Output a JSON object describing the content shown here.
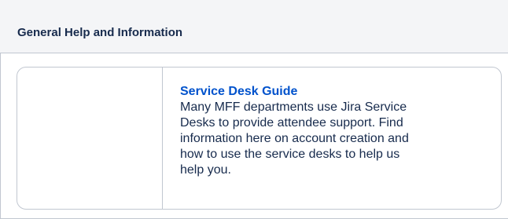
{
  "panel": {
    "title": "General Help and Information"
  },
  "card": {
    "link_label": "Service Desk Guide",
    "description_lines": [
      "Many MFF departments use Jira Service",
      "Desks to provide attendee support. Find",
      "information here on account creation and",
      "how to use the service desks to help us",
      "help you."
    ]
  },
  "colors": {
    "link": "#0052cc",
    "text": "#172b4d",
    "border": "#c1c7d0",
    "header_bg": "#f4f5f7"
  }
}
